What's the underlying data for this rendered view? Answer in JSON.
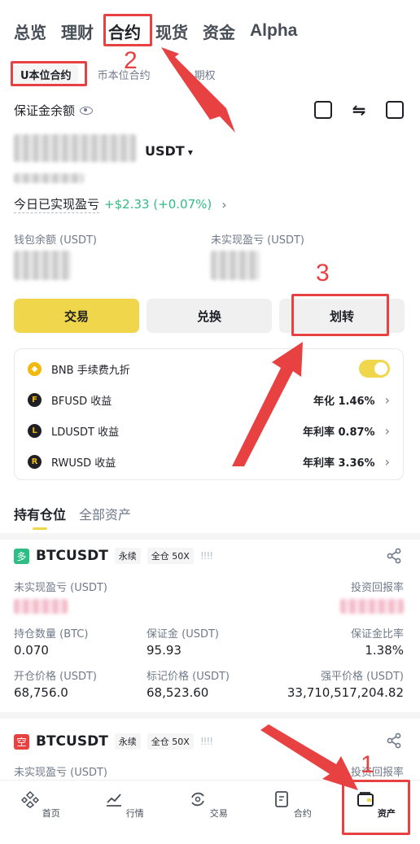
{
  "top_tabs": [
    "总览",
    "理财",
    "合约",
    "现货",
    "资金",
    "Alpha"
  ],
  "sub_tabs": [
    "U本位合约",
    "币本位合约",
    "期权"
  ],
  "account": {
    "margin_label": "保证金余额",
    "currency": "USDT",
    "today_pnl_label": "今日已实现盈亏",
    "today_pnl_value": "+$2.33 (+0.07%)",
    "wallet_label": "钱包余额 (USDT)",
    "unrealized_label": "未实现盈亏 (USDT)"
  },
  "actions": {
    "trade": "交易",
    "convert": "兑换",
    "transfer": "划转"
  },
  "promos": [
    {
      "coin": "BNB",
      "label": "BNB 手续费九折",
      "value": ""
    },
    {
      "coin": "BFUSD",
      "label": "BFUSD 收益",
      "value": "年化 1.46%"
    },
    {
      "coin": "LDUSDT",
      "label": "LDUSDT 收益",
      "value": "年利率 0.87%"
    },
    {
      "coin": "RWUSD",
      "label": "RWUSD 收益",
      "value": "年利率 3.36%"
    }
  ],
  "holdings_tabs": [
    "持有仓位",
    "全部资产"
  ],
  "positions": [
    {
      "side": "多",
      "symbol": "BTCUSDT",
      "tag1": "永续",
      "tag2": "全仓 50X",
      "bars": "!!!!",
      "unrealized_label": "未实现盈亏 (USDT)",
      "roi_label": "投资回报率",
      "size_label": "持仓数量 (BTC)",
      "size": "0.070",
      "margin_label": "保证金 (USDT)",
      "margin": "95.93",
      "ratio_label": "保证金比率",
      "ratio": "1.38%",
      "entry_label": "开仓价格 (USDT)",
      "entry": "68,756.0",
      "mark_label": "标记价格 (USDT)",
      "mark": "68,523.60",
      "liq_label": "强平价格 (USDT)",
      "liq": "33,710,517,204.82"
    },
    {
      "side": "空",
      "symbol": "BTCUSDT",
      "tag1": "永续",
      "tag2": "全仓 50X",
      "bars": "!!!!",
      "unrealized_label": "未实现盈亏 (USDT)",
      "roi_label": "投资回报率"
    }
  ],
  "bottom_nav": [
    "首页",
    "行情",
    "交易",
    "合约",
    "资产"
  ],
  "annotations": {
    "step1": "1",
    "step2": "2",
    "step3": "3"
  },
  "colors": {
    "accent": "#f0d64a",
    "highlight": "#e84142",
    "positive": "#2ebd85",
    "long": "#2ebd85",
    "short": "#e84142"
  }
}
